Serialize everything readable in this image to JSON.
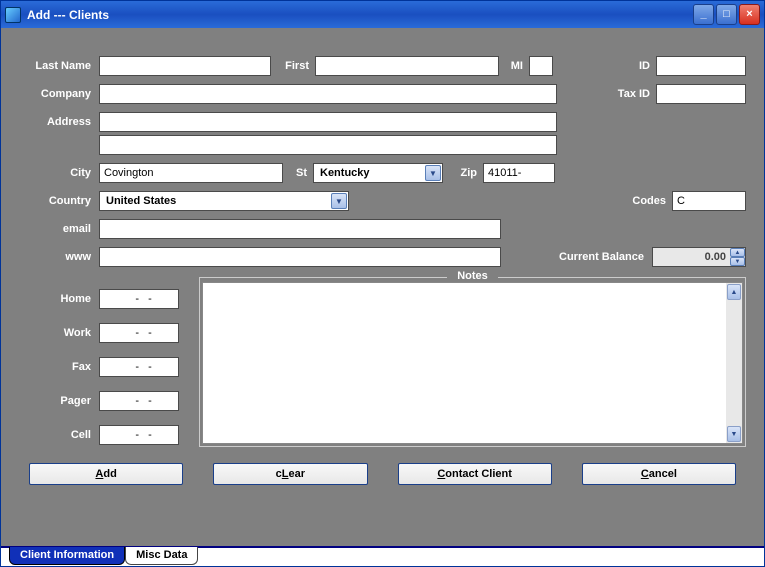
{
  "window": {
    "title": "Add --- Clients"
  },
  "labels": {
    "last_name": "Last Name",
    "first": "First",
    "mi": "MI",
    "id": "ID",
    "company": "Company",
    "tax_id": "Tax ID",
    "address": "Address",
    "city": "City",
    "st": "St",
    "zip": "Zip",
    "country": "Country",
    "codes": "Codes",
    "email": "email",
    "www": "www",
    "current_balance": "Current Balance",
    "notes": "Notes",
    "home": "Home",
    "work": "Work",
    "fax": "Fax",
    "pager": "Pager",
    "cell": "Cell"
  },
  "fields": {
    "last_name": "",
    "first": "",
    "mi": "",
    "id": "",
    "company": "",
    "tax_id": "",
    "address1": "",
    "address2": "",
    "city": "Covington",
    "state": "Kentucky",
    "zip": "41011-",
    "country": "United States",
    "codes": "C",
    "email": "",
    "www": "",
    "current_balance": "0.00",
    "phone_placeholder": "   -   -",
    "home": "   -   -",
    "work": "   -   -",
    "fax": "   -   -",
    "pager": "   -   -",
    "cell": "   -   -",
    "notes": ""
  },
  "buttons": {
    "add": "Add",
    "clear": "cLear",
    "clear_pre": "c",
    "clear_u": "L",
    "clear_post": "ear",
    "contact": "Contact Client",
    "contact_u": "C",
    "contact_post": "ontact Client",
    "cancel": "Cancel",
    "cancel_u": "C",
    "cancel_post": "ancel",
    "add_u": "A",
    "add_post": "dd"
  },
  "tabs": {
    "client_info": "Client Information",
    "misc_data": "Misc Data"
  }
}
